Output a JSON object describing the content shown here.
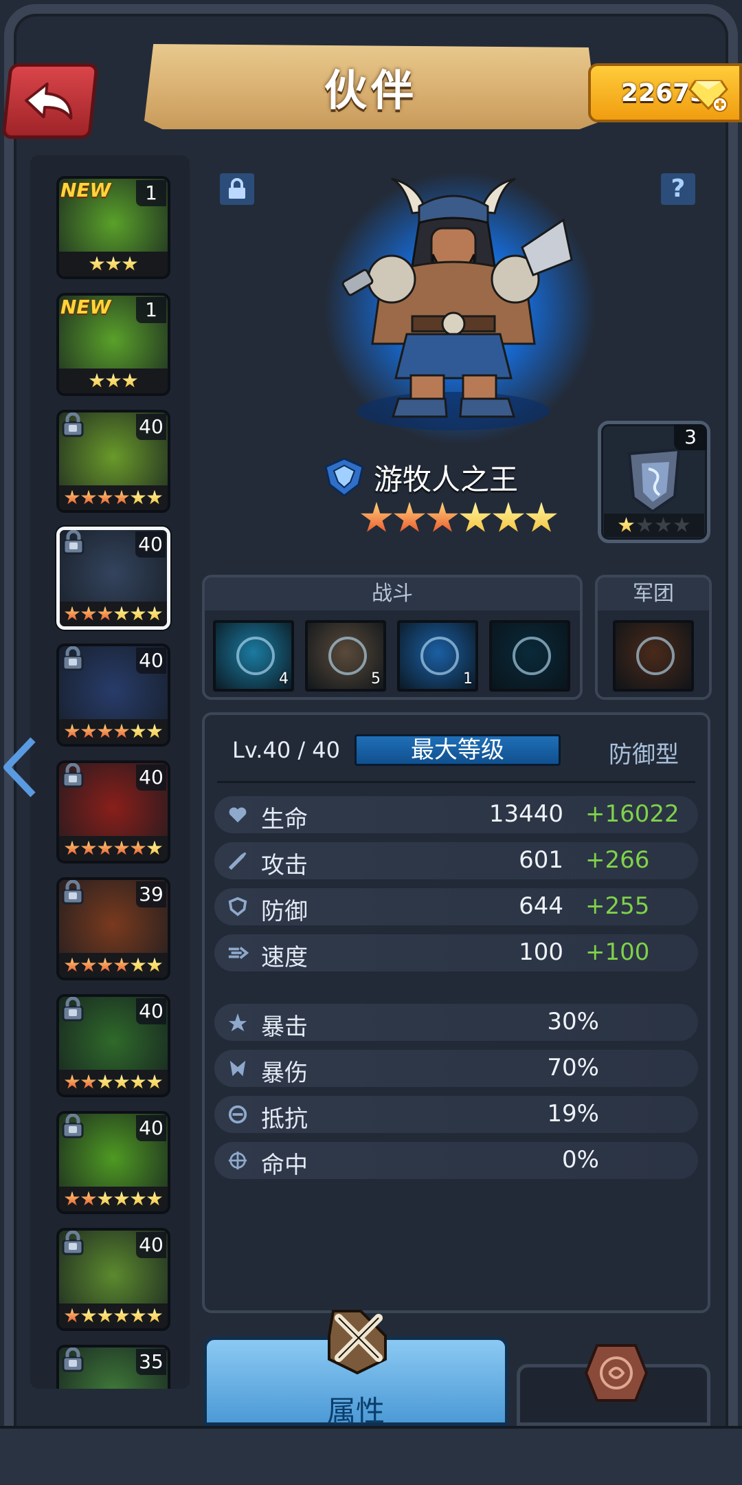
{
  "header": {
    "title": "伙伴",
    "gems": "22673"
  },
  "hero_list": [
    {
      "new_label": "NEW",
      "level": "1",
      "stars": [
        "gold",
        "gold",
        "gold"
      ],
      "locked": false,
      "palette": "#5aa12a"
    },
    {
      "new_label": "NEW",
      "level": "1",
      "stars": [
        "gold",
        "gold",
        "gold"
      ],
      "locked": false,
      "palette": "#5aa12a"
    },
    {
      "new_label": "",
      "level": "40",
      "stars": [
        "orange",
        "orange",
        "orange",
        "orange",
        "gold",
        "gold"
      ],
      "locked": true,
      "palette": "#6a9a2a"
    },
    {
      "new_label": "",
      "level": "40",
      "stars": [
        "orange",
        "orange",
        "orange",
        "gold",
        "gold",
        "gold"
      ],
      "locked": true,
      "palette": "#34445e",
      "selected": true
    },
    {
      "new_label": "",
      "level": "40",
      "stars": [
        "orange",
        "orange",
        "orange",
        "orange",
        "gold",
        "gold"
      ],
      "locked": true,
      "palette": "#283c6a"
    },
    {
      "new_label": "",
      "level": "40",
      "stars": [
        "orange",
        "orange",
        "orange",
        "orange",
        "orange",
        "gold"
      ],
      "locked": true,
      "palette": "#8a1f1a"
    },
    {
      "new_label": "",
      "level": "39",
      "stars": [
        "orange",
        "orange",
        "orange",
        "orange",
        "gold",
        "gold"
      ],
      "locked": true,
      "palette": "#7a3a1e"
    },
    {
      "new_label": "",
      "level": "40",
      "stars": [
        "orange",
        "orange",
        "gold",
        "gold",
        "gold",
        "gold"
      ],
      "locked": true,
      "palette": "#2f6a2a"
    },
    {
      "new_label": "",
      "level": "40",
      "stars": [
        "orange",
        "orange",
        "gold",
        "gold",
        "gold",
        "gold"
      ],
      "locked": true,
      "palette": "#4f9a22"
    },
    {
      "new_label": "",
      "level": "40",
      "stars": [
        "orange",
        "gold",
        "gold",
        "gold",
        "gold",
        "gold"
      ],
      "locked": true,
      "palette": "#5c8a2e"
    },
    {
      "new_label": "",
      "level": "35",
      "stars": [],
      "locked": true,
      "palette": "#3f7a38"
    }
  ],
  "hero": {
    "name": "游牧人之王",
    "stars": [
      "orange",
      "orange",
      "orange",
      "gold",
      "gold",
      "gold"
    ],
    "gear_count": "3",
    "gear_stars": [
      "gold",
      "empty",
      "empty",
      "empty"
    ]
  },
  "skills": {
    "battle_title": "战斗",
    "legion_title": "军团",
    "battle": [
      {
        "icon": "crescent-blade-icon",
        "count": "4",
        "color": "#1b7aa0"
      },
      {
        "icon": "boulder-warrior-icon",
        "count": "5",
        "color": "#5a4a3a"
      },
      {
        "icon": "rage-roar-icon",
        "count": "1",
        "color": "#1b5fa3"
      },
      {
        "icon": "rune-circle-icon",
        "count": "",
        "color": "#0a2a3a"
      }
    ],
    "legion": [
      {
        "icon": "shaman-totem-icon",
        "count": "",
        "color": "#4a2a1a"
      }
    ]
  },
  "stats": {
    "level": "Lv.40 / 40",
    "max_label": "最大等级",
    "type_label": "防御型",
    "primary": [
      {
        "icon": "heart-icon",
        "label": "生命",
        "value": "13440",
        "bonus": "+16022"
      },
      {
        "icon": "sword-icon",
        "label": "攻击",
        "value": "601",
        "bonus": "+266"
      },
      {
        "icon": "shield-icon",
        "label": "防御",
        "value": "644",
        "bonus": "+255"
      },
      {
        "icon": "speed-icon",
        "label": "速度",
        "value": "100",
        "bonus": "+100"
      }
    ],
    "secondary": [
      {
        "icon": "crit-icon",
        "label": "暴击",
        "value": "30%"
      },
      {
        "icon": "crit-damage-icon",
        "label": "暴伤",
        "value": "70%"
      },
      {
        "icon": "resist-icon",
        "label": "抵抗",
        "value": "19%"
      },
      {
        "icon": "accuracy-icon",
        "label": "命中",
        "value": "0%"
      }
    ]
  },
  "tabs": {
    "attributes_label": "属性"
  }
}
